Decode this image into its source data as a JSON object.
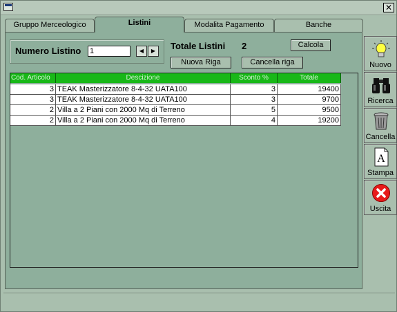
{
  "window": {
    "close_glyph": "✕"
  },
  "tabs": [
    {
      "label": "Gruppo Merceologico",
      "active": false
    },
    {
      "label": "Listini",
      "active": true
    },
    {
      "label": "Modalita Pagamento",
      "active": false
    },
    {
      "label": "Banche",
      "active": false
    }
  ],
  "form": {
    "numero_listino_label": "Numero Listino",
    "numero_listino_value": "1",
    "spin_prev": "◀",
    "spin_next": "▶",
    "totale_listini_label": "Totale Listini",
    "totale_listini_value": "2",
    "calcola_label": "Calcola",
    "nuova_riga_label": "Nuova Riga",
    "cancella_riga_label": "Cancella riga"
  },
  "grid": {
    "header_color": "#18b818",
    "columns": [
      "Cod. Articolo",
      "Descizione",
      "Sconto %",
      "Totale"
    ],
    "rows": [
      {
        "cod": "3",
        "descrizione": "TEAK Masterizzatore 8-4-32  UATA100",
        "sconto": "3",
        "totale": "19400"
      },
      {
        "cod": "3",
        "descrizione": "TEAK Masterizzatore 8-4-32  UATA100",
        "sconto": "3",
        "totale": "9700"
      },
      {
        "cod": "2",
        "descrizione": "Villa a 2 Piani con 2000 Mq di Terreno",
        "sconto": "5",
        "totale": "9500"
      },
      {
        "cod": "2",
        "descrizione": "Villa a 2 Piani con 2000 Mq di Terreno",
        "sconto": "4",
        "totale": "19200"
      }
    ]
  },
  "sidebar": [
    {
      "label": "Nuovo",
      "icon": "lightbulb-icon"
    },
    {
      "label": "Ricerca",
      "icon": "binoculars-icon"
    },
    {
      "label": "Cancella",
      "icon": "trash-icon"
    },
    {
      "label": "Stampa",
      "icon": "document-a-icon"
    },
    {
      "label": "Uscita",
      "icon": "exit-x-icon"
    }
  ]
}
